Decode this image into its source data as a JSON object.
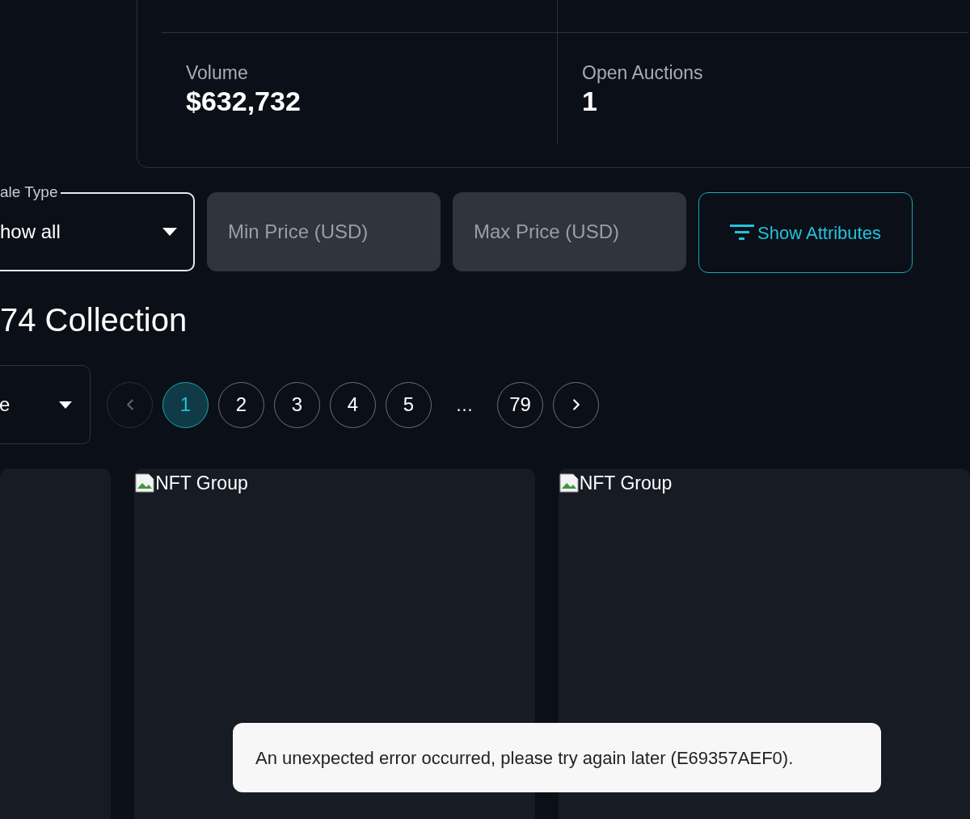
{
  "stats": [
    {
      "label": "Volume",
      "value": "$632,732"
    },
    {
      "label": "Open Auctions",
      "value": "1"
    }
  ],
  "filters": {
    "sale_type": {
      "label": "ale Type",
      "value": "how all"
    },
    "min_price": {
      "placeholder": "Min Price (USD)"
    },
    "max_price": {
      "placeholder": "Max Price (USD)"
    },
    "attributes_button": "Show Attributes"
  },
  "collection_title": "74 Collection",
  "sort": {
    "value": "e"
  },
  "pagination": [
    {
      "kind": "prev",
      "disabled": true
    },
    {
      "kind": "page",
      "label": "1",
      "selected": true
    },
    {
      "kind": "page",
      "label": "2",
      "selected": false
    },
    {
      "kind": "page",
      "label": "3",
      "selected": false
    },
    {
      "kind": "page",
      "label": "4",
      "selected": false
    },
    {
      "kind": "page",
      "label": "5",
      "selected": false
    },
    {
      "kind": "ellipsis",
      "label": "…"
    },
    {
      "kind": "page",
      "label": "79",
      "selected": false
    },
    {
      "kind": "next",
      "disabled": false
    }
  ],
  "cards": [
    {
      "kind": "blank"
    },
    {
      "kind": "broken_image",
      "image_alt": "NFT Group"
    },
    {
      "kind": "broken_image",
      "image_alt": "NFT Group"
    }
  ],
  "toast": {
    "message": "An unexpected error occurred, please try again later (E69357AEF0)."
  }
}
